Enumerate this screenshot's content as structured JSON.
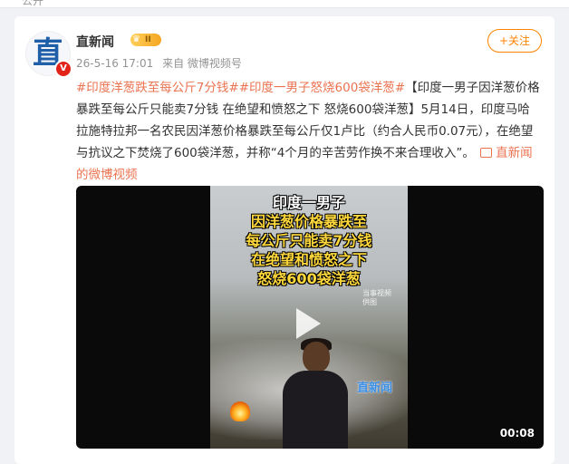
{
  "top_strip": {
    "label": "公开"
  },
  "post": {
    "author": "直新闻",
    "avatar_text": "直",
    "verified_badge": "V",
    "vip_level": "II",
    "timestamp": "26-5-16 17:01",
    "source": "来自 微博视频号",
    "follow_label": "+关注",
    "tag1": "#印度洋葱跌至每公斤7分钱#",
    "tag2": "#印度一男子怒烧600袋洋葱#",
    "body": "【印度一男子因洋葱价格暴跌至每公斤只能卖7分钱 在绝望和愤怒之下 怒烧600袋洋葱】5月14日，印度马哈拉施特拉邦一名农民因洋葱价格暴跌至每公斤仅1卢比（约合人民币0.07元），在绝望与抗议之下焚烧了600袋洋葱，并称“4个月的辛苦劳作换不来合理收入”。",
    "video_link": "直新闻的微博视频"
  },
  "video": {
    "caption_lines": [
      "印度一男子",
      "因洋葱价格暴跌至",
      "每公斤只能卖7分钱",
      "在绝望和愤怒之下",
      "怒烧600袋洋葱"
    ],
    "small_watermark": "当事视频 供图",
    "watermark": "直新闻",
    "duration": "00:08"
  },
  "colors": {
    "accent": "#ff8200",
    "tag": "#eb7350",
    "link": "#eb7350"
  }
}
